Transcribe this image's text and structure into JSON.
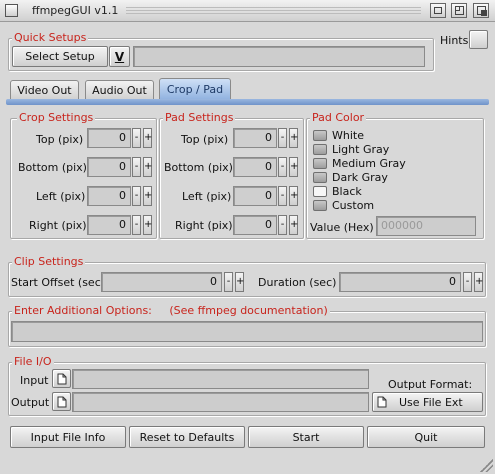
{
  "window": {
    "title": "ffmpegGUI  v1.1"
  },
  "quick_setups": {
    "label": "Quick Setups",
    "select_button": "Select Setup",
    "dropdown_glyph": "V",
    "value": ""
  },
  "hints_label": "Hints",
  "tabs": [
    "Video Out",
    "Audio Out",
    "Crop / Pad"
  ],
  "crop": {
    "label": "Crop Settings",
    "rows": [
      {
        "label": "Top (pix)",
        "value": "0"
      },
      {
        "label": "Bottom (pix)",
        "value": "0"
      },
      {
        "label": "Left (pix)",
        "value": "0"
      },
      {
        "label": "Right (pix)",
        "value": "0"
      }
    ]
  },
  "pad": {
    "label": "Pad Settings",
    "rows": [
      {
        "label": "Top (pix)",
        "value": "0"
      },
      {
        "label": "Bottom (pix)",
        "value": "0"
      },
      {
        "label": "Left (pix)",
        "value": "0"
      },
      {
        "label": "Right (pix)",
        "value": "0"
      }
    ]
  },
  "pad_color": {
    "label": "Pad Color",
    "options": [
      "White",
      "Light Gray",
      "Medium Gray",
      "Dark Gray",
      "Black",
      "Custom"
    ],
    "selected": "Black",
    "value_label": "Value (Hex)",
    "value_placeholder": "000000"
  },
  "clip": {
    "label": "Clip Settings",
    "start_label": "Start Offset (sec)",
    "start_value": "0",
    "duration_label": "Duration (sec)",
    "duration_value": "0"
  },
  "options": {
    "label": "Enter Additional Options:     (See ffmpeg documentation)",
    "value": ""
  },
  "file_io": {
    "label": "File I/O",
    "input_label": "Input",
    "input_value": "",
    "output_label": "Output",
    "output_value": "",
    "format_label": "Output Format:",
    "format_button": "Use File Ext"
  },
  "spin": {
    "minus": "-",
    "plus": "+"
  },
  "bottom_buttons": [
    "Input File Info",
    "Reset to Defaults",
    "Start",
    "Quit"
  ]
}
